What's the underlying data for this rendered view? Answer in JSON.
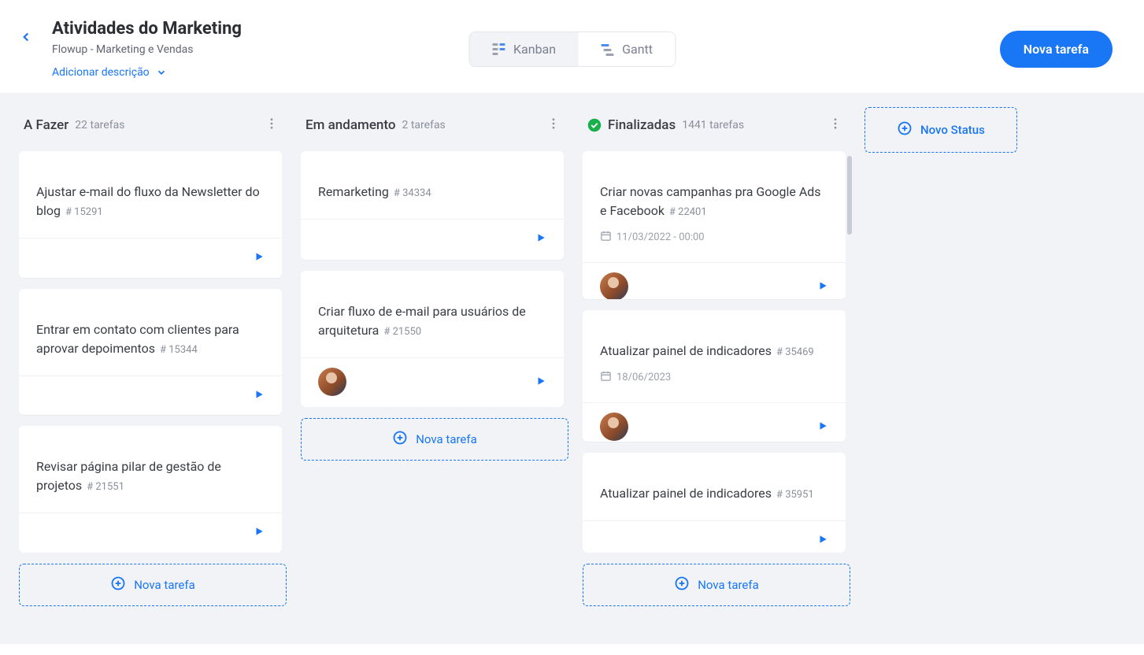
{
  "header": {
    "title": "Atividades do Marketing",
    "subtitle": "Flowup - Marketing e Vendas",
    "add_description": "Adicionar descrição",
    "view_kanban": "Kanban",
    "view_gantt": "Gantt",
    "new_task_button": "Nova tarefa"
  },
  "board": {
    "new_task_col_label": "Nova tarefa",
    "new_status_label": "Novo Status",
    "columns": [
      {
        "title": "A Fazer",
        "count_label": "22 tarefas",
        "has_check": false,
        "cards": [
          {
            "title": "Ajustar e-mail do fluxo da Newsletter do blog",
            "id": "# 15291",
            "date": "",
            "avatar": false
          },
          {
            "title": "Entrar em contato com clientes para aprovar depoimentos",
            "id": "# 15344",
            "date": "",
            "avatar": false
          },
          {
            "title": "Revisar página pilar de gestão de projetos",
            "id": "# 21551",
            "date": "",
            "avatar": false
          }
        ]
      },
      {
        "title": "Em andamento",
        "count_label": "2 tarefas",
        "has_check": false,
        "cards": [
          {
            "title": "Remarketing",
            "id": "# 34334",
            "date": "",
            "avatar": false
          },
          {
            "title": "Criar fluxo de e-mail para usuários de arquitetura",
            "id": "# 21550",
            "date": "",
            "avatar": true
          }
        ]
      },
      {
        "title": "Finalizadas",
        "count_label": "1441 tarefas",
        "has_check": true,
        "cards": [
          {
            "title": "Criar novas campanhas pra Google Ads e Facebook",
            "id": "# 22401",
            "date": "11/03/2022 - 00:00",
            "avatar": true
          },
          {
            "title": "Atualizar painel de indicadores",
            "id": "# 35469",
            "date": "18/06/2023",
            "avatar": true
          },
          {
            "title": "Atualizar painel de indicadores",
            "id": "# 35951",
            "date": "",
            "avatar": false
          }
        ]
      }
    ]
  }
}
